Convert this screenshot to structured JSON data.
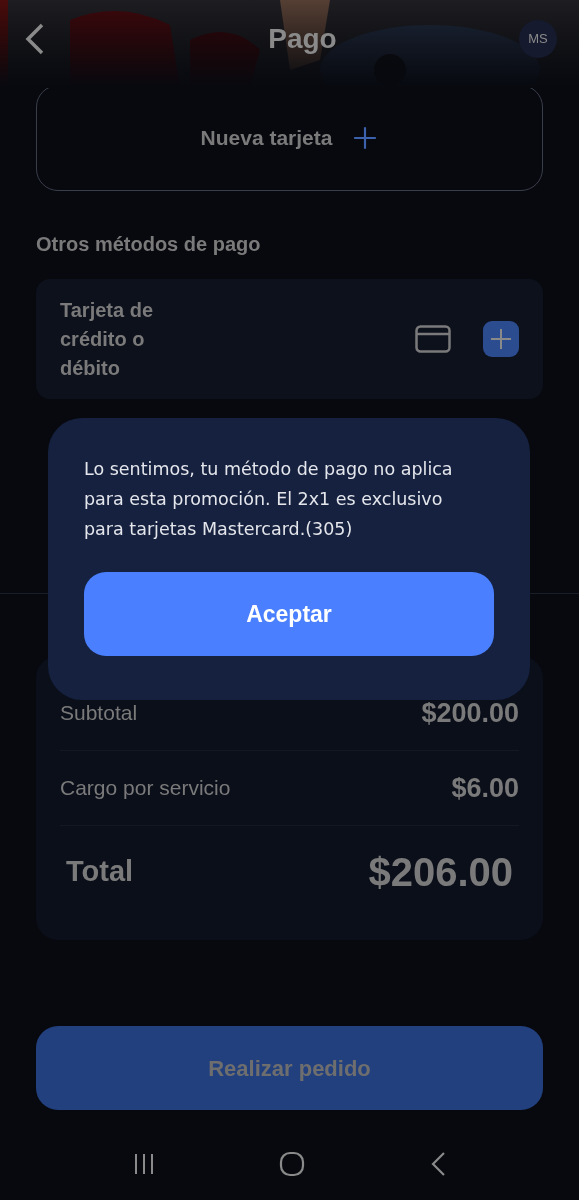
{
  "header": {
    "title": "Pago",
    "avatar": "MS"
  },
  "new_card": {
    "label": "Nueva tarjeta"
  },
  "section_title": "Otros métodos de pago",
  "methods": [
    {
      "label": "Tarjeta de crédito o débito"
    }
  ],
  "summary": [
    {
      "kind": "row",
      "label": "Subtotal",
      "value": "$200.00"
    },
    {
      "kind": "row",
      "label": "Cargo por servicio",
      "value": "$6.00"
    },
    {
      "kind": "total",
      "label": "Total",
      "value": "$206.00"
    }
  ],
  "order_button": {
    "label": "Realizar pedido",
    "disabled": true
  },
  "dialog": {
    "message": "Lo sentimos, tu método de pago no aplica para esta promoción. El 2x1 es exclusivo para tarjetas Mastercard.(305)",
    "button": "Aceptar"
  }
}
